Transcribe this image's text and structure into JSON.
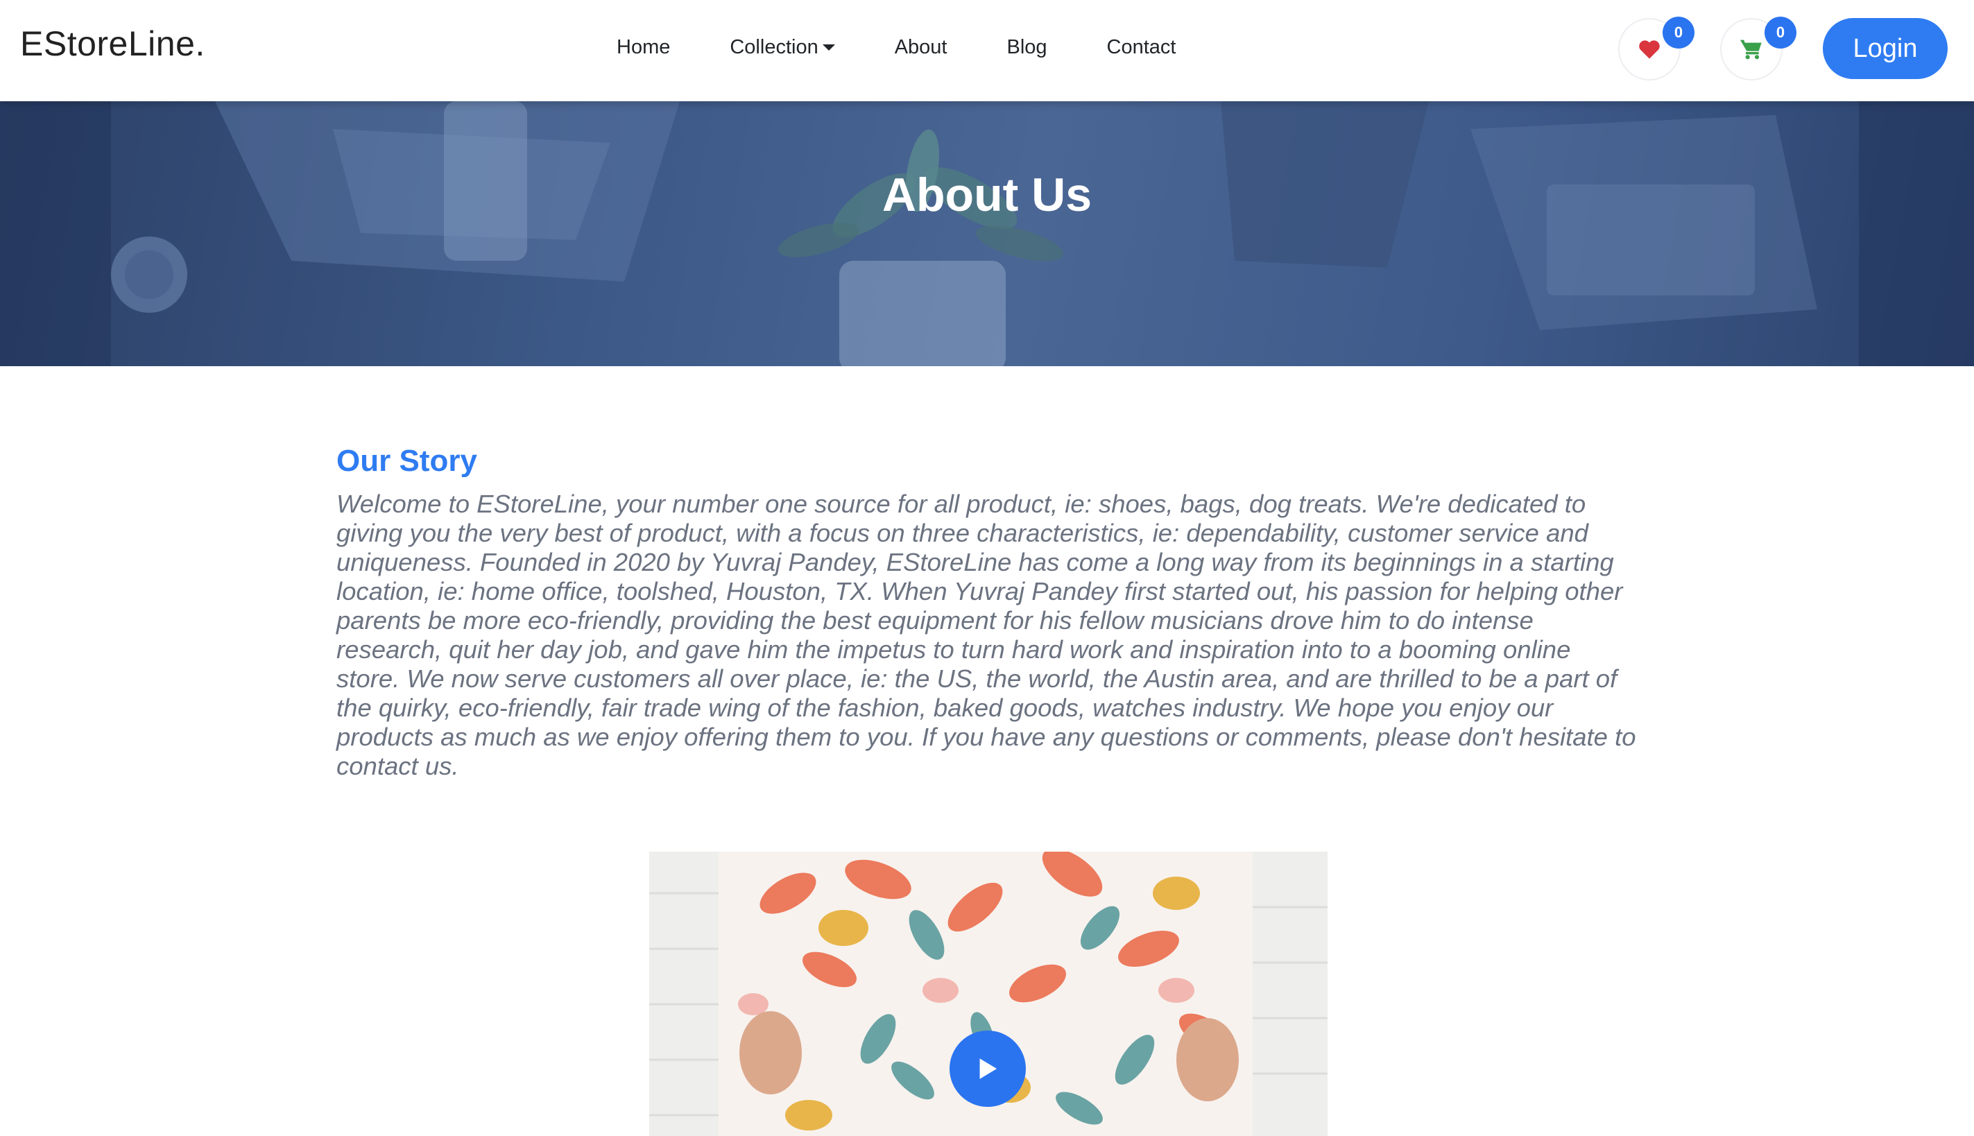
{
  "navbar": {
    "brand": "EStoreLine.",
    "links": [
      {
        "label": "Home"
      },
      {
        "label": "Collection"
      },
      {
        "label": "About"
      },
      {
        "label": "Blog"
      },
      {
        "label": "Contact"
      }
    ],
    "wishlist": {
      "icon": "heart-icon",
      "count": "0",
      "color": "#d9363e"
    },
    "cart": {
      "icon": "cart-icon",
      "count": "0",
      "color": "#3aa04a"
    },
    "login_label": "Login"
  },
  "hero": {
    "title": "About Us"
  },
  "story": {
    "heading": "Our Story",
    "body": "Welcome to EStoreLine, your number one source for all product, ie: shoes, bags, dog treats. We're dedicated to giving you the very best of product, with a focus on three characteristics, ie: dependability, customer service and uniqueness. Founded in 2020 by Yuvraj Pandey, EStoreLine has come a long way from its beginnings in a starting location, ie: home office, toolshed, Houston, TX. When Yuvraj Pandey first started out, his passion for helping other parents be more eco-friendly, providing the best equipment for his fellow musicians drove him to do intense research, quit her day job, and gave him the impetus to turn hard work and inspiration into to a booming online store. We now serve customers all over place, ie: the US, the world, the Austin area, and are thrilled to be a part of the quirky, eco-friendly, fair trade wing of the fashion, baked goods, watches industry. We hope you enjoy our products as much as we enjoy offering them to you. If you have any questions or comments, please don't hesitate to contact us."
  },
  "video": {
    "play_icon": "play-icon"
  },
  "colors": {
    "accent": "#2f7cf2",
    "hero_overlay": "#3c5886",
    "body_text": "#6b7280"
  }
}
